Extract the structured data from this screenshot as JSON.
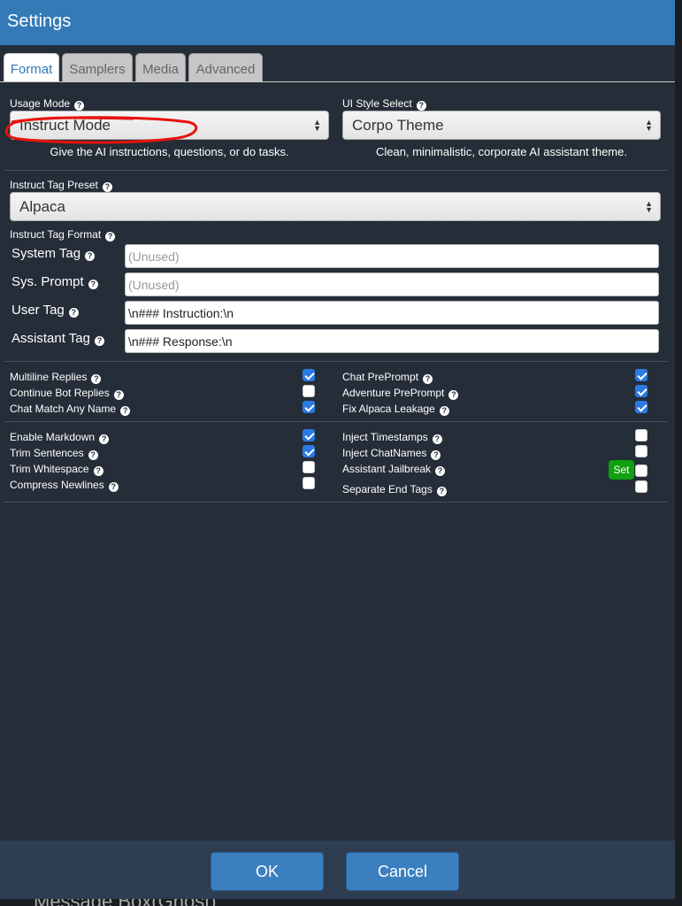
{
  "window": {
    "title": "Settings"
  },
  "tabs": [
    {
      "label": "Format"
    },
    {
      "label": "Samplers"
    },
    {
      "label": "Media"
    },
    {
      "label": "Advanced"
    }
  ],
  "usage_mode": {
    "label": "Usage Mode",
    "value": "Instruct Mode",
    "description": "Give the AI instructions, questions, or do tasks."
  },
  "ui_style": {
    "label": "UI Style Select",
    "value": "Corpo Theme",
    "description": "Clean, minimalistic, corporate AI assistant theme."
  },
  "instruct_preset": {
    "label": "Instruct Tag Preset",
    "value": "Alpaca"
  },
  "instruct_format": {
    "label": "Instruct Tag Format",
    "system_tag": {
      "label": "System Tag",
      "placeholder": "(Unused)",
      "value": ""
    },
    "sys_prompt": {
      "label": "Sys. Prompt",
      "placeholder": "(Unused)",
      "value": ""
    },
    "user_tag": {
      "label": "User Tag",
      "value": "\\n### Instruction:\\n"
    },
    "assistant_tag": {
      "label": "Assistant Tag",
      "value": "\\n### Response:\\n"
    }
  },
  "options_group1_left": [
    {
      "label": "Multiline Replies",
      "checked": true
    },
    {
      "label": "Continue Bot Replies",
      "checked": false
    },
    {
      "label": "Chat Match Any Name",
      "checked": true
    }
  ],
  "options_group1_right": [
    {
      "label": "Chat PrePrompt",
      "checked": true
    },
    {
      "label": "Adventure PrePrompt",
      "checked": true
    },
    {
      "label": "Fix Alpaca Leakage",
      "checked": true
    }
  ],
  "options_group2_left": [
    {
      "label": "Enable Markdown",
      "checked": true
    },
    {
      "label": "Trim Sentences",
      "checked": true
    },
    {
      "label": "Trim Whitespace",
      "checked": false
    },
    {
      "label": "Compress Newlines",
      "checked": false
    }
  ],
  "options_group2_right": [
    {
      "label": "Inject Timestamps",
      "checked": false
    },
    {
      "label": "Inject ChatNames",
      "checked": false
    },
    {
      "label": "Assistant Jailbreak",
      "checked": false
    },
    {
      "label": "Separate End Tags",
      "checked": false
    }
  ],
  "jailbreak_set_label": "Set",
  "help_glyph": "?",
  "footer": {
    "ok_label": "OK",
    "cancel_label": "Cancel"
  },
  "background_text": "Message Box(Ghost)",
  "colors": {
    "titlebar": "#337ab7",
    "panel": "#252d38",
    "checkbox_on": "#2a7ae2",
    "set_button": "#10a010",
    "annotation": "#e8120c"
  }
}
